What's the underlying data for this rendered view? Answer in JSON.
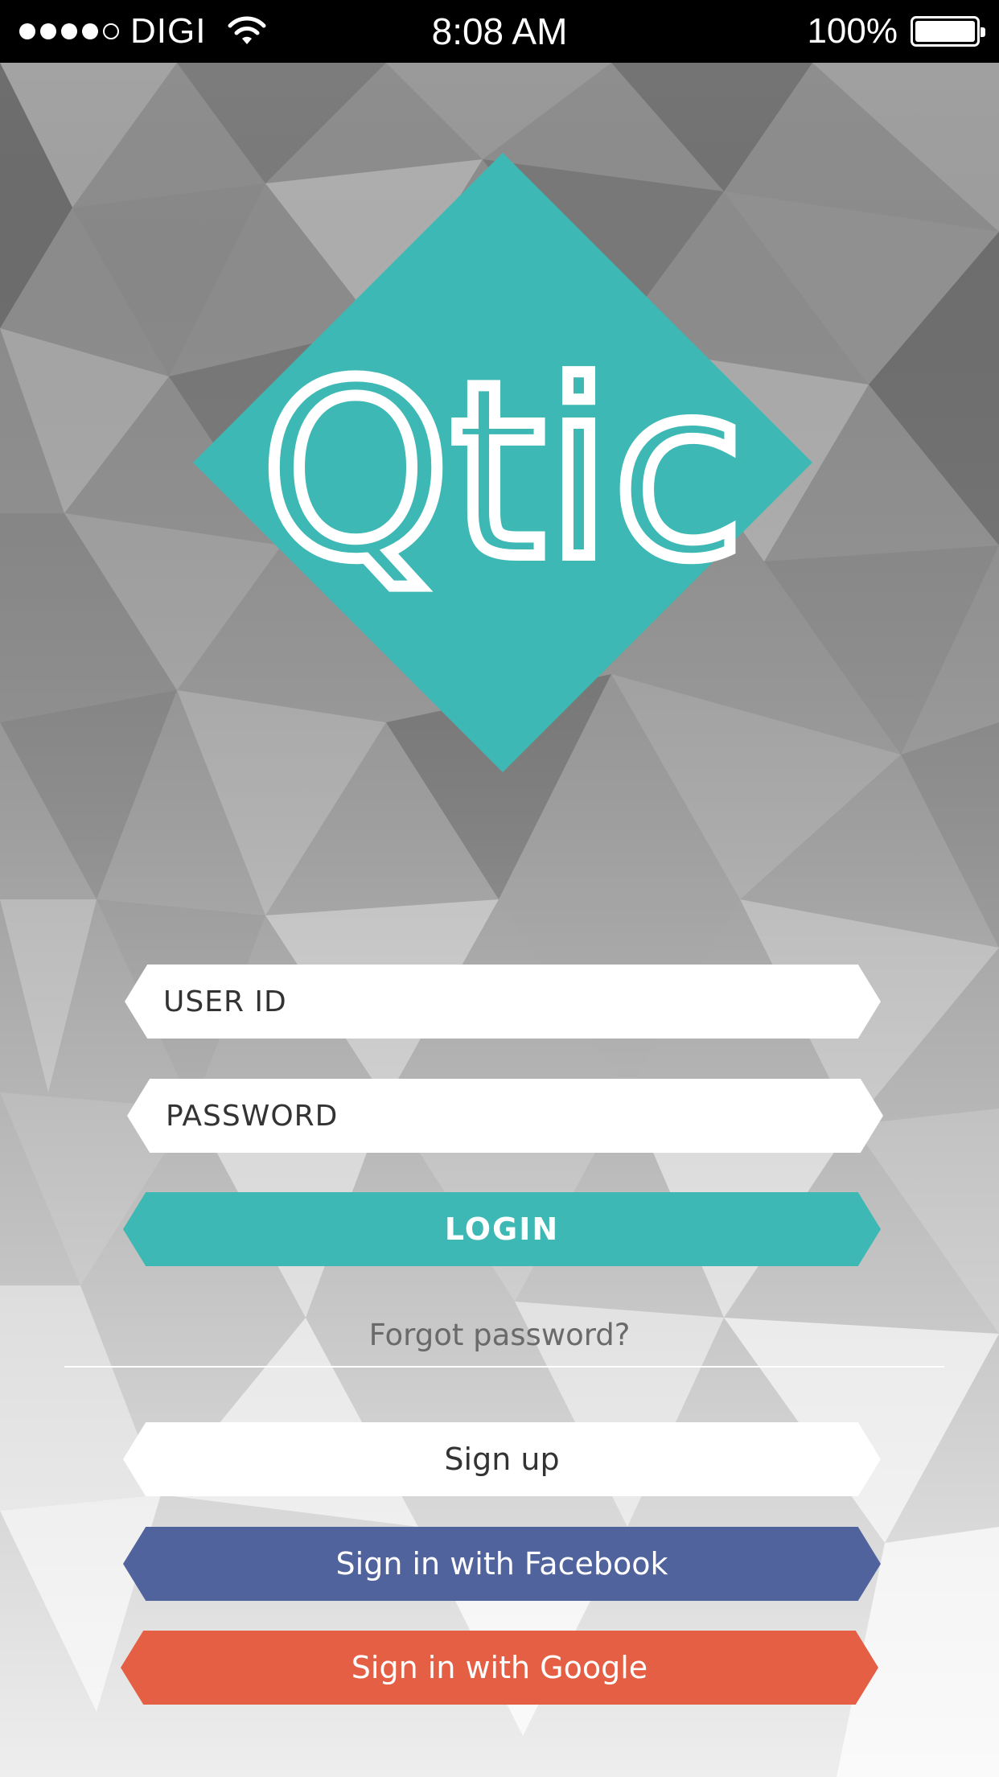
{
  "status_bar": {
    "carrier": "DIGI",
    "time": "8:08 AM",
    "battery": "100%",
    "signal_bars_filled": 4,
    "signal_bars_total": 5
  },
  "logo": {
    "text": "Qtic",
    "background_color": "#3db8b4"
  },
  "login_form": {
    "user_id_placeholder": "USER ID",
    "password_placeholder": "PASSWORD",
    "login_label": "LOGIN",
    "forgot_password": "Forgot password?"
  },
  "alt_auth": {
    "signup_label": "Sign up",
    "facebook_label": "Sign in with Facebook",
    "google_label": "Sign in with Google"
  },
  "colors": {
    "accent": "#3db8b4",
    "facebook": "#51639c",
    "google": "#e55f45"
  }
}
